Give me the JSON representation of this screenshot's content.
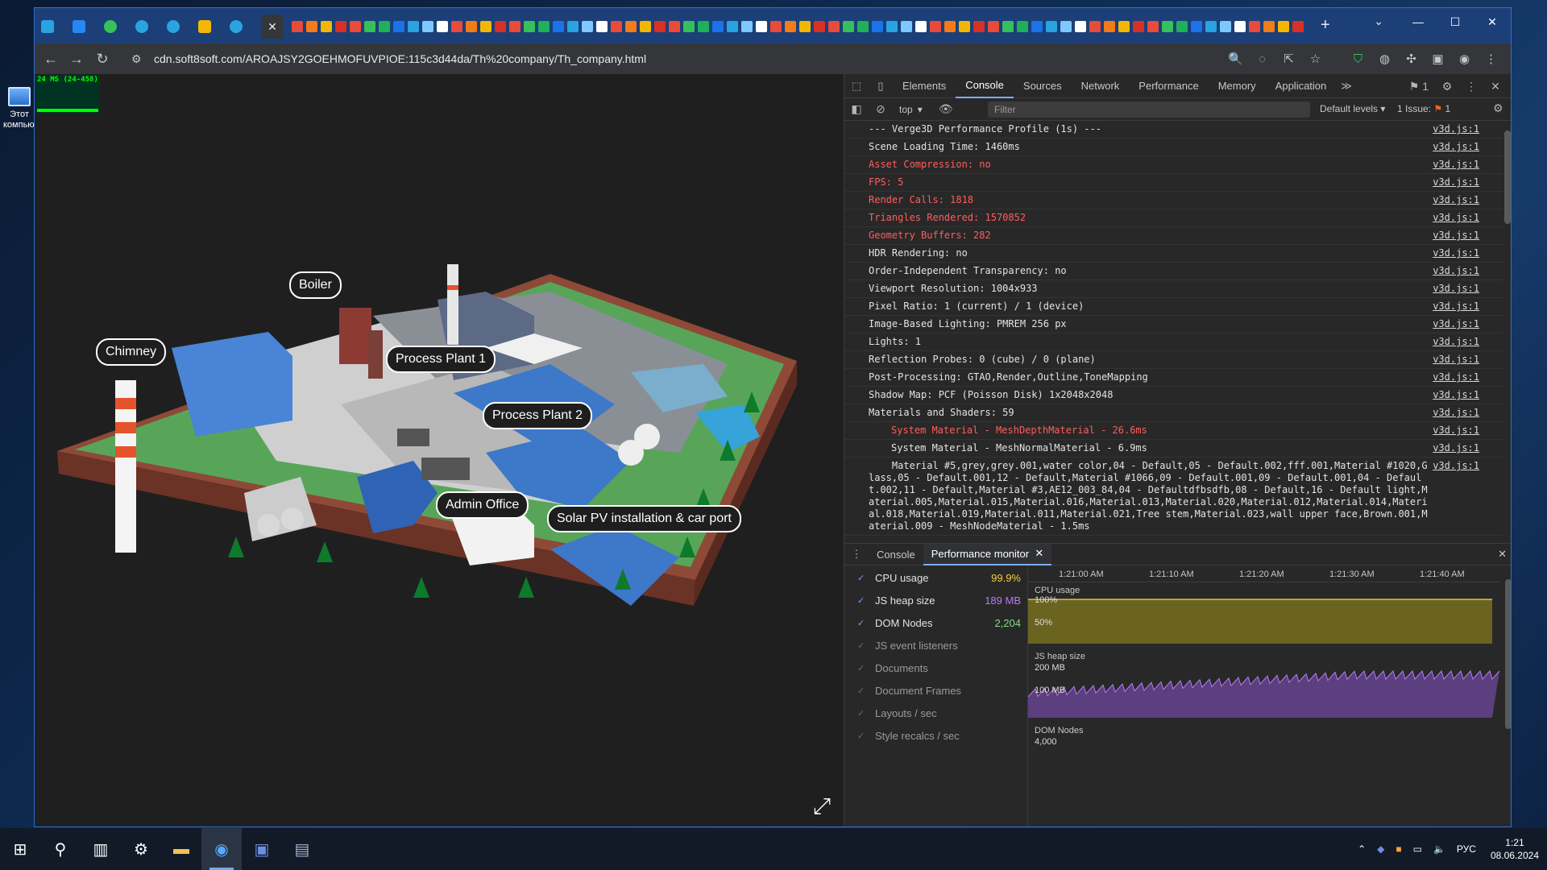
{
  "desktop": {
    "icon_label": "Этот компьютер"
  },
  "browser": {
    "address": "cdn.soft8soft.com/AROAJSY2GOEHMOFUVPIOE:115c3d44da/Th%20company/Th_company.html",
    "window_controls": {
      "minimize": "—",
      "maximize": "☐",
      "close": "✕"
    },
    "tab_close": "✕",
    "new_tab": "+"
  },
  "viewport": {
    "fps_text": "24 MS (24-458)",
    "labels": {
      "chimney": "Chimney",
      "boiler": "Boiler",
      "process_plant_1": "Process Plant 1",
      "process_plant_2": "Process Plant 2",
      "admin_office": "Admin Office",
      "solar": "Solar PV installation & car port"
    }
  },
  "devtools": {
    "tabs": [
      "Elements",
      "Console",
      "Sources",
      "Network",
      "Performance",
      "Memory",
      "Application"
    ],
    "active_tab": "Console",
    "issues_badge": "1",
    "context": "top",
    "filter_placeholder": "Filter",
    "levels": "Default levels",
    "issues_text": "1 Issue:",
    "issues_count": "1",
    "log": [
      {
        "text": "--- Verge3D Performance Profile (1s) ---",
        "src": "v3d.js:1",
        "level": "info"
      },
      {
        "text": "Scene Loading Time: 1460ms",
        "src": "v3d.js:1",
        "level": "info"
      },
      {
        "text": "Asset Compression: no",
        "src": "v3d.js:1",
        "level": "err"
      },
      {
        "text": "FPS: 5",
        "src": "v3d.js:1",
        "level": "err"
      },
      {
        "text": "Render Calls: 1818",
        "src": "v3d.js:1",
        "level": "err"
      },
      {
        "text": "Triangles Rendered: 1570852",
        "src": "v3d.js:1",
        "level": "err"
      },
      {
        "text": "Geometry Buffers: 282",
        "src": "v3d.js:1",
        "level": "err"
      },
      {
        "text": "HDR Rendering: no",
        "src": "v3d.js:1",
        "level": "info"
      },
      {
        "text": "Order-Independent Transparency: no",
        "src": "v3d.js:1",
        "level": "info"
      },
      {
        "text": "Viewport Resolution: 1004x933",
        "src": "v3d.js:1",
        "level": "info"
      },
      {
        "text": "Pixel Ratio: 1 (current) / 1 (device)",
        "src": "v3d.js:1",
        "level": "info"
      },
      {
        "text": "Image-Based Lighting: PMREM 256 px",
        "src": "v3d.js:1",
        "level": "info"
      },
      {
        "text": "Lights: 1",
        "src": "v3d.js:1",
        "level": "info"
      },
      {
        "text": "Reflection Probes: 0 (cube) / 0 (plane)",
        "src": "v3d.js:1",
        "level": "info"
      },
      {
        "text": "Post-Processing: GTAO,Render,Outline,ToneMapping",
        "src": "v3d.js:1",
        "level": "info"
      },
      {
        "text": "Shadow Map: PCF (Poisson Disk) 1x2048x2048",
        "src": "v3d.js:1",
        "level": "info"
      },
      {
        "text": "Materials and Shaders: 59",
        "src": "v3d.js:1",
        "level": "info"
      },
      {
        "text": "System Material - MeshDepthMaterial - 26.6ms",
        "src": "v3d.js:1",
        "level": "err-indent"
      },
      {
        "text": "System Material - MeshNormalMaterial - 6.9ms",
        "src": "v3d.js:1",
        "level": "indent"
      },
      {
        "text": "    Material #5,grey,grey.001,water color,04 - Default,05 - Default.002,fff.001,Material #1020,Glass,05 - Default.001,12 - Default,Material #1066,09 - Default.001,09 - Default.001,04 - Default.002,11 - Default,Material #3,AE12_003_84,04 - Defaultdfbsdfb,08 - Default,16 - Default light,Material.005,Material.015,Material.016,Material.013,Material.020,Material.012,Material.014,Material.018,Material.019,Material.011,Material.021,Tree stem,Material.023,wall upper face,Brown.001,Material.009 - MeshNodeMaterial - 1.5ms",
        "src": "v3d.js:1",
        "level": "info"
      }
    ],
    "drawer": {
      "tabs": [
        "Console",
        "Performance monitor"
      ],
      "active": "Performance monitor"
    },
    "perf": {
      "metrics": [
        {
          "label": "CPU usage",
          "value": "99.9%",
          "color": "#f5d042",
          "on": true
        },
        {
          "label": "JS heap size",
          "value": "189 MB",
          "color": "#b67cf7",
          "on": true
        },
        {
          "label": "DOM Nodes",
          "value": "2,204",
          "color": "#7ee07e",
          "on": true
        },
        {
          "label": "JS event listeners",
          "value": "",
          "color": "",
          "on": false
        },
        {
          "label": "Documents",
          "value": "",
          "color": "",
          "on": false
        },
        {
          "label": "Document Frames",
          "value": "",
          "color": "",
          "on": false
        },
        {
          "label": "Layouts / sec",
          "value": "",
          "color": "",
          "on": false
        },
        {
          "label": "Style recalcs / sec",
          "value": "",
          "color": "",
          "on": false
        }
      ],
      "times": [
        "1:21:00 AM",
        "1:21:10 AM",
        "1:21:20 AM",
        "1:21:30 AM",
        "1:21:40 AM"
      ],
      "cpu": {
        "title": "CPU usage",
        "t100": "100%",
        "t50": "50%",
        "level": 0.98
      },
      "heap": {
        "title": "JS heap size",
        "t200": "200 MB",
        "t100": "100 MB"
      },
      "dom": {
        "title": "DOM Nodes",
        "t4000": "4,000"
      }
    }
  },
  "taskbar": {
    "lang": "РУС",
    "time": "1:21",
    "date": "08.06.2024"
  }
}
